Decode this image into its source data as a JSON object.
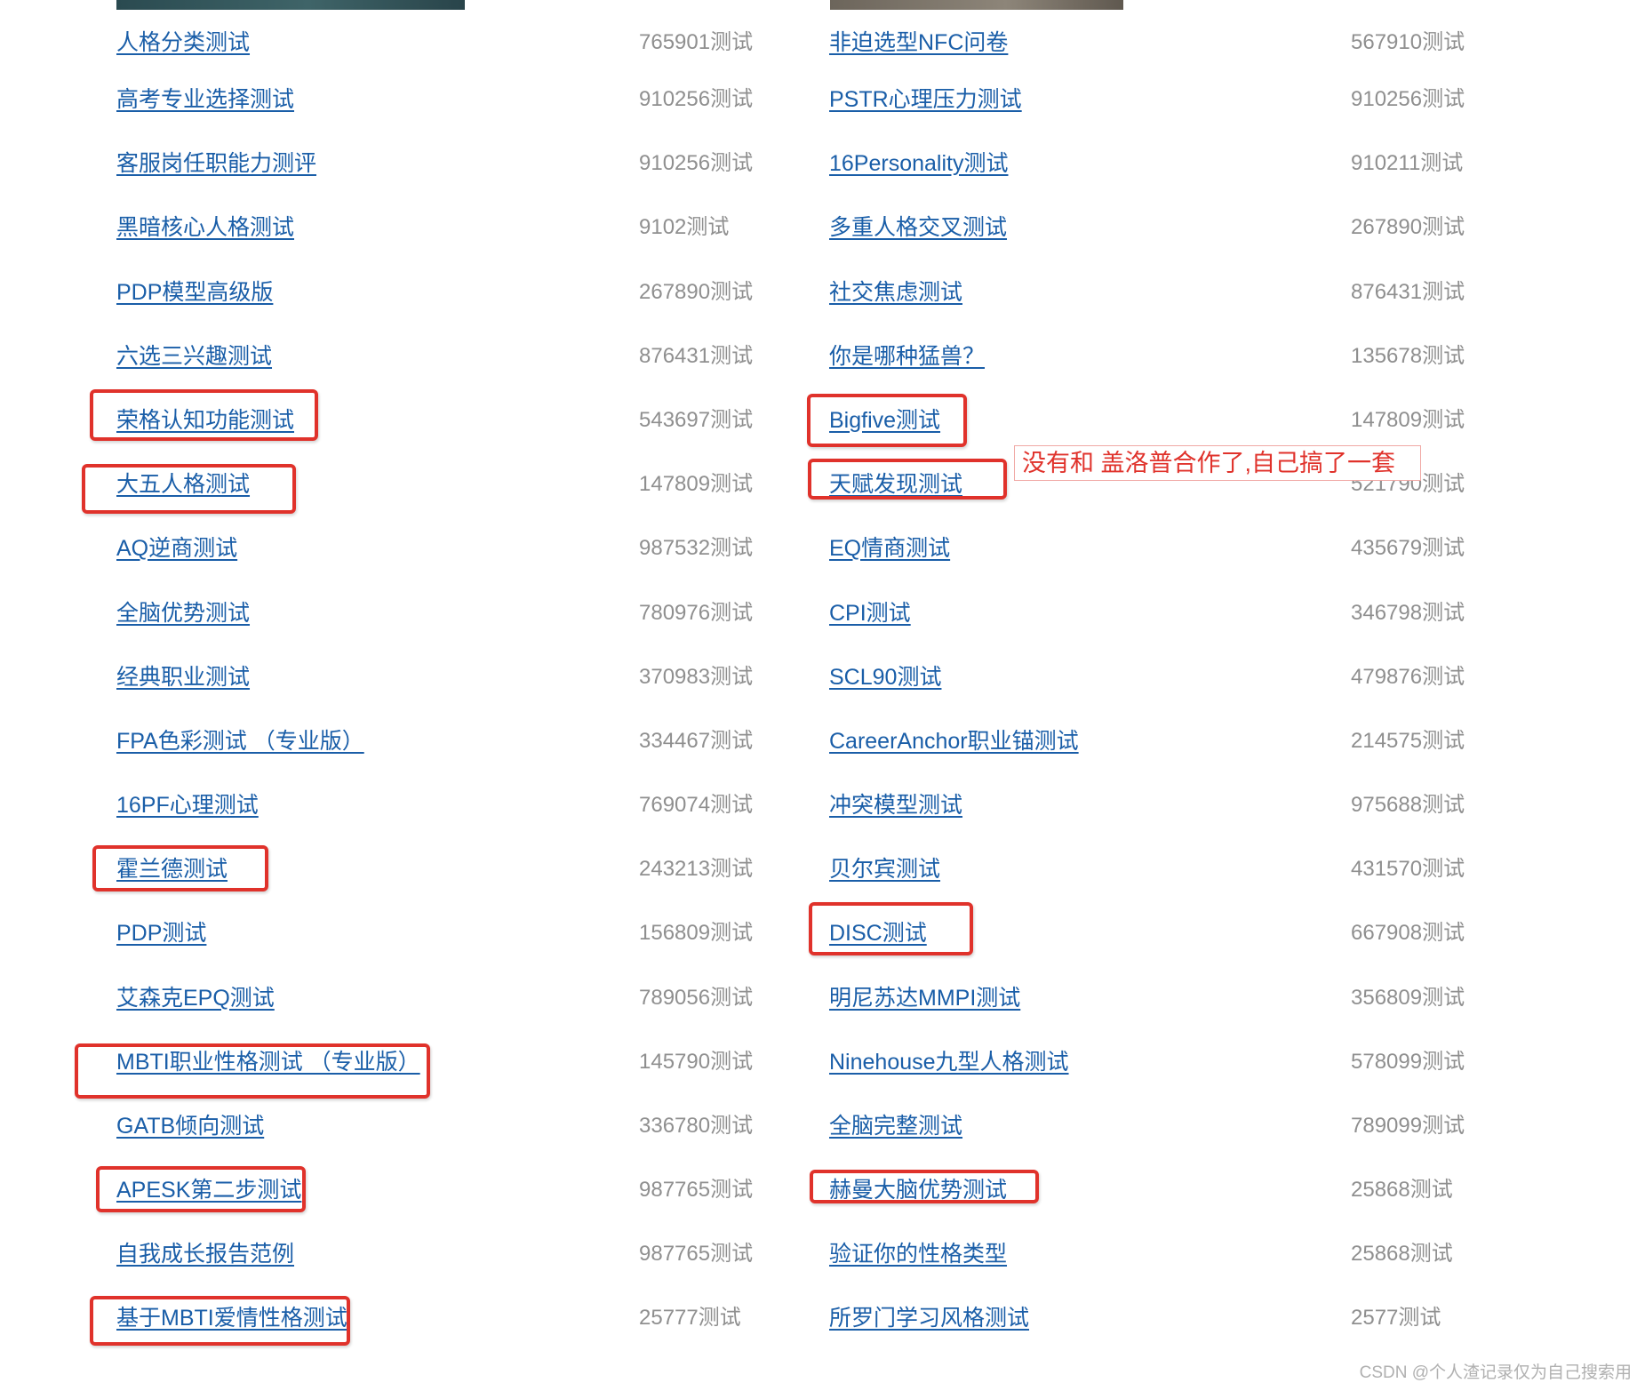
{
  "left_column": [
    {
      "name": "人格分类测试",
      "count": "765901测试"
    },
    {
      "name": "高考专业选择测试",
      "count": "910256测试"
    },
    {
      "name": "客服岗任职能力测评",
      "count": "910256测试"
    },
    {
      "name": "黑暗核心人格测试",
      "count": "9102测试"
    },
    {
      "name": "PDP模型高级版",
      "count": "267890测试"
    },
    {
      "name": "六选三兴趣测试",
      "count": "876431测试"
    },
    {
      "name": "荣格认知功能测试",
      "count": "543697测试"
    },
    {
      "name": "大五人格测试",
      "count": "147809测试"
    },
    {
      "name": "AQ逆商测试",
      "count": "987532测试"
    },
    {
      "name": "全脑优势测试",
      "count": "780976测试"
    },
    {
      "name": "经典职业测试",
      "count": "370983测试"
    },
    {
      "name": "FPA色彩测试 （专业版）",
      "count": "334467测试"
    },
    {
      "name": "16PF心理测试",
      "count": "769074测试"
    },
    {
      "name": "霍兰德测试",
      "count": "243213测试"
    },
    {
      "name": "PDP测试",
      "count": "156809测试"
    },
    {
      "name": "艾森克EPQ测试",
      "count": "789056测试"
    },
    {
      "name": "MBTI职业性格测试 （专业版）",
      "count": "145790测试"
    },
    {
      "name": "GATB倾向测试",
      "count": "336780测试"
    },
    {
      "name": "APESK第二步测试",
      "count": "987765测试"
    },
    {
      "name": "自我成长报告范例",
      "count": "987765测试"
    },
    {
      "name": "基于MBTI爱情性格测试",
      "count": "25777测试"
    }
  ],
  "right_column": [
    {
      "name": "非迫选型NFC问卷",
      "count": "567910测试"
    },
    {
      "name": "PSTR心理压力测试",
      "count": "910256测试"
    },
    {
      "name": "16Personality测试",
      "count": "910211测试"
    },
    {
      "name": "多重人格交叉测试",
      "count": "267890测试"
    },
    {
      "name": "社交焦虑测试",
      "count": "876431测试"
    },
    {
      "name": "你是哪种猛兽？",
      "count": "135678测试"
    },
    {
      "name": "Bigfive测试",
      "count": "147809测试"
    },
    {
      "name": "天赋发现测试",
      "count": "521790测试"
    },
    {
      "name": "EQ情商测试",
      "count": "435679测试"
    },
    {
      "name": "CPI测试",
      "count": "346798测试"
    },
    {
      "name": "SCL90测试",
      "count": "479876测试"
    },
    {
      "name": "CareerAnchor职业锚测试",
      "count": "214575测试"
    },
    {
      "name": "冲突模型测试",
      "count": "975688测试"
    },
    {
      "name": "贝尔宾测试",
      "count": "431570测试"
    },
    {
      "name": "DISC测试",
      "count": "667908测试"
    },
    {
      "name": "明尼苏达MMPI测试",
      "count": "356809测试"
    },
    {
      "name": "Ninehouse九型人格测试",
      "count": "578099测试"
    },
    {
      "name": "全脑完整测试",
      "count": "789099测试"
    },
    {
      "name": "赫曼大脑优势测试",
      "count": "25868测试"
    },
    {
      "name": "验证你的性格类型",
      "count": "25868测试"
    },
    {
      "name": "所罗门学习风格测试",
      "count": "2577测试"
    }
  ],
  "annotation_note": "没有和 盖洛普合作了,自己搞了一套",
  "watermark": "CSDN @个人渣记录仅为自己搜索用",
  "colors": {
    "link": "#1a5ea8",
    "count": "#8f8f8f",
    "highlight": "#e0322b"
  }
}
